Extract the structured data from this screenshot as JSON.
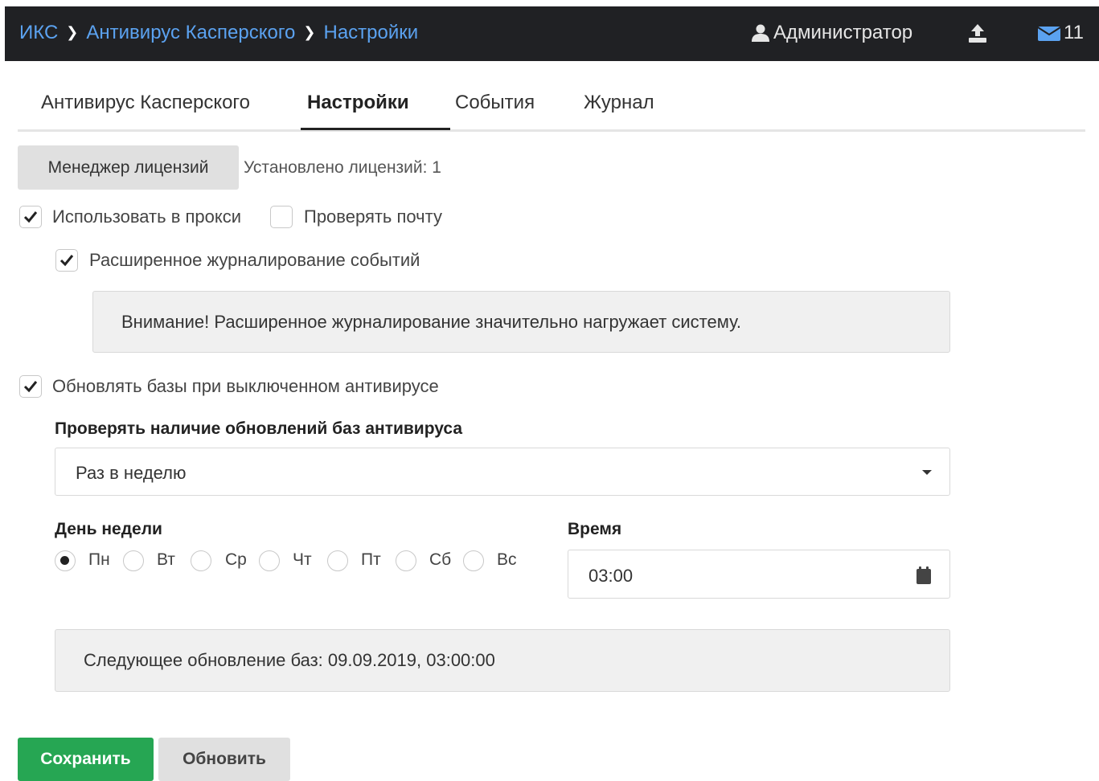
{
  "header": {
    "breadcrumb": [
      "ИКС",
      "Антивирус Касперского",
      "Настройки"
    ],
    "user": "Администратор",
    "mail_count": "11",
    "icons": [
      "user-icon",
      "upload-icon",
      "envelope-icon"
    ]
  },
  "tabs": [
    {
      "label": "Антивирус Касперского",
      "active": false
    },
    {
      "label": "Настройки",
      "active": true
    },
    {
      "label": "События",
      "active": false
    },
    {
      "label": "Журнал",
      "active": false
    }
  ],
  "license": {
    "button_label": "Менеджер лицензий",
    "installed_text": "Установлено лицензий: 1"
  },
  "options": {
    "use_in_proxy": {
      "label": "Использовать в прокси",
      "checked": true
    },
    "check_mail": {
      "label": "Проверять почту",
      "checked": false
    },
    "extended_logging": {
      "label": "Расширенное журналирование событий",
      "checked": true
    },
    "logging_warning": "Внимание! Расширенное журналирование значительно нагружает систему.",
    "update_when_disabled": {
      "label": "Обновлять базы при выключенном антивирусе",
      "checked": true
    }
  },
  "update_schedule": {
    "label": "Проверять наличие обновлений баз антивируса",
    "selected": "Раз в неделю",
    "weekday_label": "День недели",
    "weekdays": [
      "Пн",
      "Вт",
      "Ср",
      "Чт",
      "Пт",
      "Сб",
      "Вс"
    ],
    "weekday_selected": "Пн",
    "time_label": "Время",
    "time_value": "03:00",
    "next_update": "Следующее обновление баз: 09.09.2019, 03:00:00"
  },
  "actions": {
    "save_label": "Сохранить",
    "refresh_label": "Обновить"
  },
  "colors": {
    "topbar_bg": "#202124",
    "link_blue": "#5ba2f0",
    "save_green": "#26a653",
    "button_gray": "#e0e0e0",
    "notice_bg": "#f0f0f0"
  }
}
